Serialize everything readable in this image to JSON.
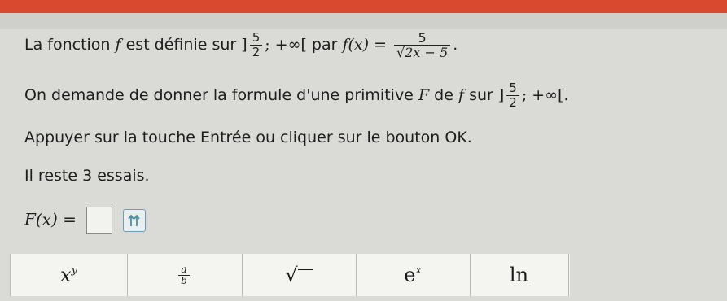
{
  "intro": {
    "prefix": "La fonction",
    "fn": "f",
    "text1": "est définie sur",
    "open_bracket": "]",
    "frac_num": "5",
    "frac_den": "2",
    "interval_end": "; +∞[",
    "par": "par",
    "fdef_lhs": "f(x)",
    "equals": "=",
    "fdef_num": "5",
    "fdef_den": "√2x − 5",
    "period": "."
  },
  "demand": {
    "text": "On demande de donner la formule d'une primitive",
    "F": "F",
    "de": "de",
    "f": "f",
    "sur": "sur",
    "open_bracket": "]",
    "frac_num": "5",
    "frac_den": "2",
    "interval_end": "; +∞[."
  },
  "instruction": "Appuyer sur la touche Entrée ou cliquer sur le bouton OK.",
  "tries": "Il reste 3 essais.",
  "answer": {
    "lhs": "F(x)",
    "equals": "=",
    "value": ""
  },
  "toolbar": {
    "power": {
      "base": "x",
      "exp": "y"
    },
    "fraction": {
      "num": "a",
      "den": "b"
    },
    "sqrt": "√",
    "exp": {
      "base": "e",
      "exp": "x"
    },
    "ln": "ln"
  },
  "colors": {
    "accent_bar": "#d9492f",
    "background": "#dadad6"
  }
}
